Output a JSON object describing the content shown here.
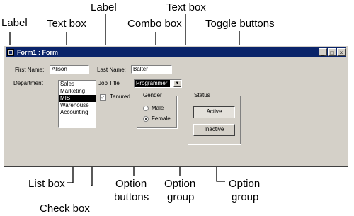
{
  "callouts": {
    "label_1": "Label",
    "text_box_1": "Text box",
    "label_2": "Label",
    "text_box_2": "Text box",
    "combo_box": "Combo box",
    "toggle_buttons": "Toggle buttons",
    "list_box": "List box",
    "check_box": "Check box",
    "option_buttons_1": "Option",
    "option_buttons_2": "buttons",
    "option_group_1a": "Option",
    "option_group_1b": "group",
    "option_group_2a": "Option",
    "option_group_2b": "group"
  },
  "window": {
    "title": "Form1 : Form",
    "minimize_glyph": "_",
    "maximize_glyph": "□",
    "close_glyph": "×"
  },
  "form": {
    "first_name_label": "First Name:",
    "first_name_value": "Alison",
    "last_name_label": "Last Name:",
    "last_name_value": "Balter",
    "department_label": "Department",
    "departments": [
      "Sales",
      "Marketing",
      "MIS",
      "Warehouse",
      "Accounting"
    ],
    "selected_department": "MIS",
    "job_title_label": "Job Title",
    "job_title_value": "Programmer",
    "combo_arrow": "▼",
    "tenured_label": "Tenured",
    "tenured_mark": "✓",
    "gender_legend": "Gender",
    "gender_options": [
      "Male",
      "Female"
    ],
    "gender_selected": "Female",
    "status_legend": "Status",
    "status_active": "Active",
    "status_inactive": "Inactive"
  },
  "icons": [
    "form-icon",
    "minimize-icon",
    "maximize-icon",
    "close-icon",
    "dropdown-arrow-icon",
    "checkmark-icon"
  ]
}
